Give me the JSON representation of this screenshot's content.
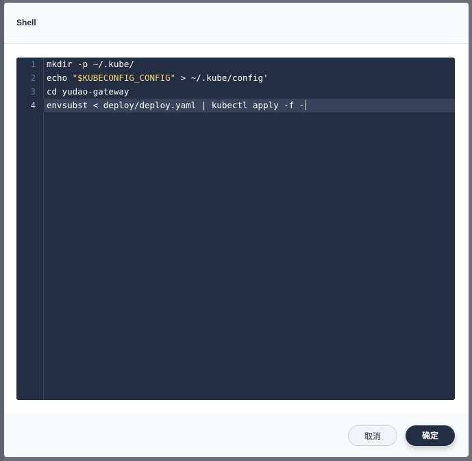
{
  "dialog": {
    "title": "Shell"
  },
  "editor": {
    "active_line": 4,
    "lines": [
      {
        "num": "1",
        "code": "mkdir -p ~/.kube/"
      },
      {
        "num": "2",
        "pre": "echo ",
        "str": "\"$KUBECONFIG_CONFIG\"",
        "post": " > ~/.kube/config'"
      },
      {
        "num": "3",
        "code": "cd yudao-gateway"
      },
      {
        "num": "4",
        "code": "envsubst < deploy/deploy.yaml | kubectl apply -f -"
      }
    ],
    "colors": {
      "background": "#242e42",
      "string": "#f5d774",
      "active_line": "#36435a"
    }
  },
  "footer": {
    "cancel_label": "取消",
    "ok_label": "确定"
  }
}
